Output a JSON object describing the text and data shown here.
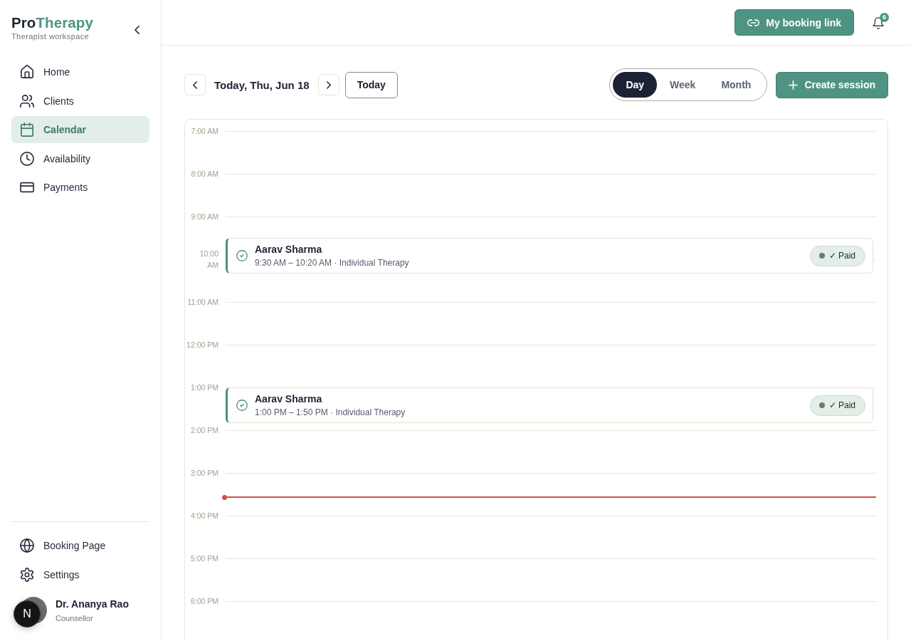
{
  "sidebar": {
    "brand": {
      "lead": "Pro",
      "accent": "Therapy"
    },
    "tagline": "Therapist workspace",
    "nav": [
      {
        "label": "Home",
        "selected": false
      },
      {
        "label": "Clients",
        "selected": false
      },
      {
        "label": "Calendar",
        "selected": true
      },
      {
        "label": "Availability",
        "selected": false
      },
      {
        "label": "Payments",
        "selected": false
      }
    ],
    "footer_nav": [
      {
        "label": "Booking Page",
        "selected": false
      },
      {
        "label": "Settings",
        "selected": false
      }
    ],
    "user": {
      "name": "Dr. Ananya Rao",
      "role": "Counsellor"
    }
  },
  "header": {
    "booking_link": "My booking link",
    "notification_count": "6"
  },
  "toolbar": {
    "date": "Today, Thu, Jun 18",
    "today": "Today",
    "views": [
      {
        "label": "Day",
        "selected": true
      },
      {
        "label": "Week",
        "selected": false
      },
      {
        "label": "Month",
        "selected": false
      }
    ],
    "create": "Create session"
  },
  "calendar": {
    "hours": [
      {
        "label": "7:00 AM",
        "current": false
      },
      {
        "label": "8:00 AM",
        "current": false
      },
      {
        "label": "9:00 AM",
        "current": false
      },
      {
        "label": "10:00 AM",
        "current": false
      },
      {
        "label": "11:00 AM",
        "current": false
      },
      {
        "label": "12:00 PM",
        "current": false
      },
      {
        "label": "1:00 PM",
        "current": false
      },
      {
        "label": "2:00 PM",
        "current": false
      },
      {
        "label": "3:00 PM",
        "current": true
      },
      {
        "label": "4:00 PM",
        "current": false
      },
      {
        "label": "5:00 PM",
        "current": false
      },
      {
        "label": "6:00 PM",
        "current": false
      }
    ],
    "sessions": [
      {
        "client": "Aarav Sharma",
        "details": "9:30 AM – 10:20 AM · Individual Therapy",
        "status": "✓ Paid"
      },
      {
        "client": "Aarav Sharma",
        "details": "1:00 PM – 1:50 PM · Individual Therapy",
        "status": "✓ Paid"
      }
    ]
  },
  "dev_indicator": {
    "label": "N"
  }
}
